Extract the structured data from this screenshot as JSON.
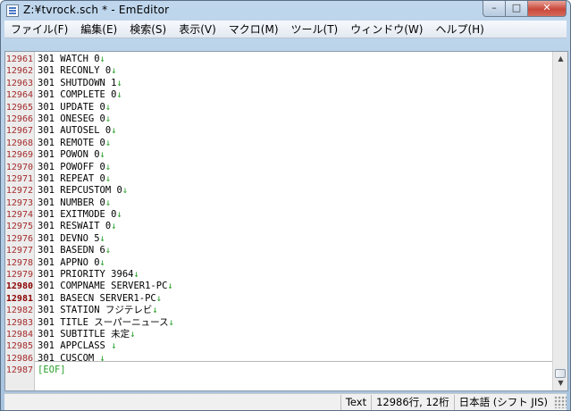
{
  "window": {
    "title": "Z:¥tvrock.sch * - EmEditor",
    "buttons": {
      "minimize": "–",
      "maximize": "□",
      "close": "✕"
    }
  },
  "menu": [
    "ファイル(F)",
    "編集(E)",
    "検索(S)",
    "表示(V)",
    "マクロ(M)",
    "ツール(T)",
    "ウィンドウ(W)",
    "ヘルプ(H)"
  ],
  "editor": {
    "lines": [
      {
        "n": "12961",
        "text": "301 WATCH 0",
        "eol": "↓"
      },
      {
        "n": "12962",
        "text": "301 RECONLY 0",
        "eol": "↓"
      },
      {
        "n": "12963",
        "text": "301 SHUTDOWN 1",
        "eol": "↓"
      },
      {
        "n": "12964",
        "text": "301 COMPLETE 0",
        "eol": "↓"
      },
      {
        "n": "12965",
        "text": "301 UPDATE 0",
        "eol": "↓"
      },
      {
        "n": "12966",
        "text": "301 ONESEG 0",
        "eol": "↓"
      },
      {
        "n": "12967",
        "text": "301 AUTOSEL 0",
        "eol": "↓"
      },
      {
        "n": "12968",
        "text": "301 REMOTE 0",
        "eol": "↓"
      },
      {
        "n": "12969",
        "text": "301 POWON 0",
        "eol": "↓"
      },
      {
        "n": "12970",
        "text": "301 POWOFF 0",
        "eol": "↓"
      },
      {
        "n": "12971",
        "text": "301 REPEAT 0",
        "eol": "↓"
      },
      {
        "n": "12972",
        "text": "301 REPCUSTOM 0",
        "eol": "↓"
      },
      {
        "n": "12973",
        "text": "301 NUMBER 0",
        "eol": "↓"
      },
      {
        "n": "12974",
        "text": "301 EXITMODE 0",
        "eol": "↓"
      },
      {
        "n": "12975",
        "text": "301 RESWAIT 0",
        "eol": "↓"
      },
      {
        "n": "12976",
        "text": "301 DEVNO 5",
        "eol": "↓"
      },
      {
        "n": "12977",
        "text": "301 BASEDN 6",
        "eol": "↓"
      },
      {
        "n": "12978",
        "text": "301 APPNO 0",
        "eol": "↓"
      },
      {
        "n": "12979",
        "text": "301 PRIORITY 3964",
        "eol": "↓"
      },
      {
        "n": "12980",
        "text": "301 COMPNAME SERVER1-PC",
        "eol": "↓",
        "current": true
      },
      {
        "n": "12981",
        "text": "301 BASECN SERVER1-PC",
        "eol": "↓",
        "current": true
      },
      {
        "n": "12982",
        "text": "301 STATION フジテレビ",
        "eol": "↓"
      },
      {
        "n": "12983",
        "text": "301 TITLE スーパーニュース",
        "eol": "↓"
      },
      {
        "n": "12984",
        "text": "301 SUBTITLE 未定",
        "eol": "↓"
      },
      {
        "n": "12985",
        "text": "301 APPCLASS ",
        "eol": "↓"
      },
      {
        "n": "12986",
        "text": "301 CUSCOM ",
        "eol": "↓"
      }
    ],
    "eof_line": {
      "n": "12987",
      "text": "[EOF]"
    }
  },
  "status": {
    "mode": "Text",
    "position": "12986行, 12桁",
    "encoding": "日本語 (シフト JIS)"
  }
}
